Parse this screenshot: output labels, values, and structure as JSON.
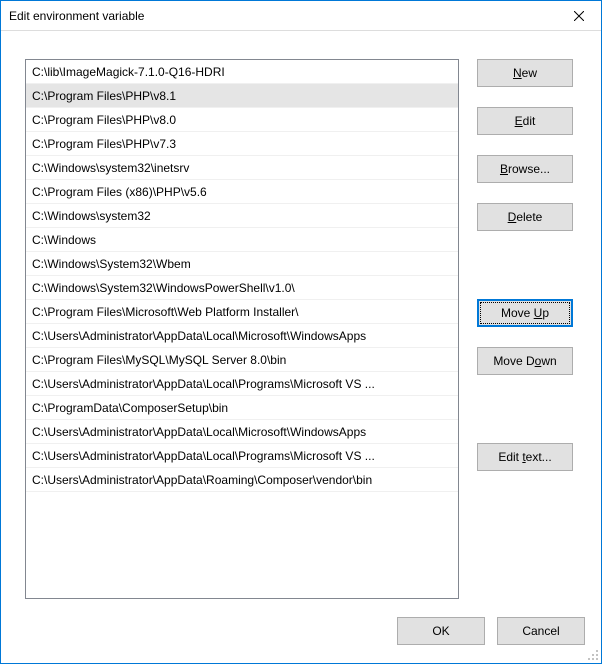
{
  "title": "Edit environment variable",
  "list": {
    "selected_index": 1,
    "items": [
      "C:\\lib\\ImageMagick-7.1.0-Q16-HDRI",
      "C:\\Program Files\\PHP\\v8.1",
      "C:\\Program Files\\PHP\\v8.0",
      "C:\\Program Files\\PHP\\v7.3",
      "C:\\Windows\\system32\\inetsrv",
      "C:\\Program Files (x86)\\PHP\\v5.6",
      "C:\\Windows\\system32",
      "C:\\Windows",
      "C:\\Windows\\System32\\Wbem",
      "C:\\Windows\\System32\\WindowsPowerShell\\v1.0\\",
      "C:\\Program Files\\Microsoft\\Web Platform Installer\\",
      "C:\\Users\\Administrator\\AppData\\Local\\Microsoft\\WindowsApps",
      "C:\\Program Files\\MySQL\\MySQL Server 8.0\\bin",
      "C:\\Users\\Administrator\\AppData\\Local\\Programs\\Microsoft VS ...",
      "C:\\ProgramData\\ComposerSetup\\bin",
      "C:\\Users\\Administrator\\AppData\\Local\\Microsoft\\WindowsApps",
      "C:\\Users\\Administrator\\AppData\\Local\\Programs\\Microsoft VS ...",
      "C:\\Users\\Administrator\\AppData\\Roaming\\Composer\\vendor\\bin"
    ]
  },
  "buttons": {
    "new_pre": "",
    "new_accel": "N",
    "new_post": "ew",
    "edit_pre": "",
    "edit_accel": "E",
    "edit_post": "dit",
    "browse_pre": "",
    "browse_accel": "B",
    "browse_post": "rowse...",
    "delete_pre": "",
    "delete_accel": "D",
    "delete_post": "elete",
    "moveup_pre": "Move ",
    "moveup_accel": "U",
    "moveup_post": "p",
    "movedown_pre": "Move D",
    "movedown_accel": "o",
    "movedown_post": "wn",
    "edittext_pre": "Edit ",
    "edittext_accel": "t",
    "edittext_post": "ext...",
    "ok": "OK",
    "cancel": "Cancel"
  }
}
